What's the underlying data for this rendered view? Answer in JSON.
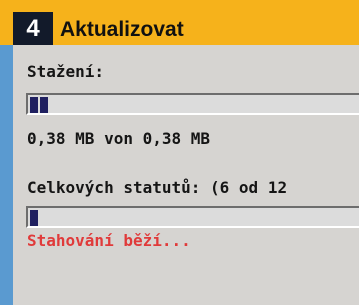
{
  "header": {
    "step_number": "4",
    "title": "Aktualizovat"
  },
  "dialog": {
    "download_label": "Stažení:",
    "download_progress_blocks": 2,
    "size_text": "0,38 MB von 0,38 MB",
    "total_label": "Celkových statutů: (6 od 12",
    "total_progress_blocks": 1,
    "status_text": "Stahování běží..."
  },
  "colors": {
    "header_bg": "#f6b21b",
    "badge_bg": "#121a2a",
    "dialog_bg": "#d6d4d1",
    "progress_fill": "#202060",
    "status_text": "#e03a3a",
    "outer_bg": "#5a9ad0"
  }
}
